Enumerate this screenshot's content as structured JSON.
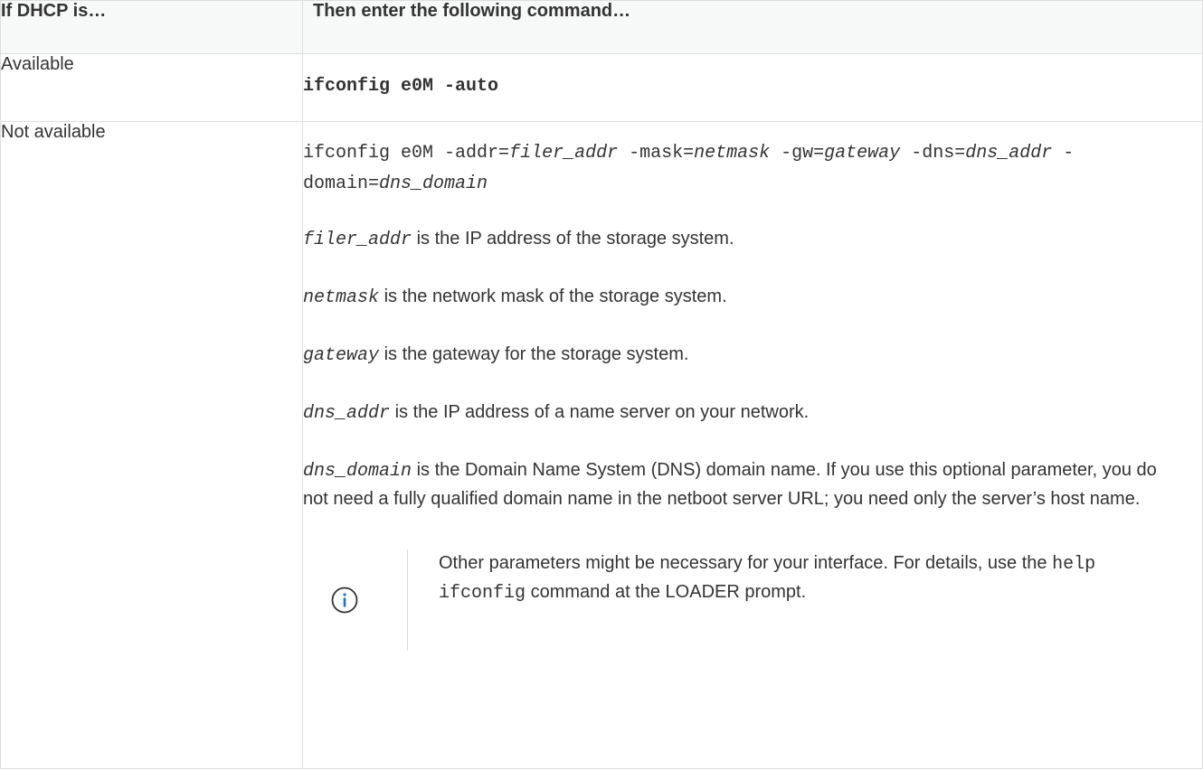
{
  "header": {
    "col1": "If DHCP is…",
    "col2": "Then enter the following command…"
  },
  "rows": {
    "available": {
      "label": "Available",
      "command": "ifconfig e0M -auto"
    },
    "not_available": {
      "label": "Not available",
      "command": {
        "cmd": "ifconfig e0M",
        "addr_flag": "-addr=",
        "addr_var": "filer_addr",
        "mask_flag": "-mask=",
        "mask_var": "netmask",
        "gw_flag": "-gw=",
        "gw_var": "gateway",
        "dns_flag": "-dns=",
        "dns_var": "dns_addr",
        "domain_flag": "-domain=",
        "domain_var": "dns_domain"
      },
      "params": [
        {
          "name": "filer_addr",
          "desc": "is the IP address of the storage system."
        },
        {
          "name": "netmask",
          "desc": "is the network mask of the storage system."
        },
        {
          "name": "gateway",
          "desc": "is the gateway for the storage system."
        },
        {
          "name": "dns_addr",
          "desc": "is the IP address of a name server on your network."
        },
        {
          "name": "dns_domain",
          "desc": "is the Domain Name System (DNS) domain name. If you use this optional parameter, you do not need a fully qualified domain name in the netboot server URL; you need only the server’s host name."
        }
      ],
      "note": {
        "icon": "info-icon",
        "text_before": "Other parameters might be necessary for your interface. For details, use the",
        "code": "help ifconfig",
        "text_after": "command at the LOADER prompt."
      }
    }
  },
  "colors": {
    "border": "#dedede",
    "header_bg": "#f7f8f8",
    "text": "#333333",
    "info_icon": "#1a73c9"
  }
}
